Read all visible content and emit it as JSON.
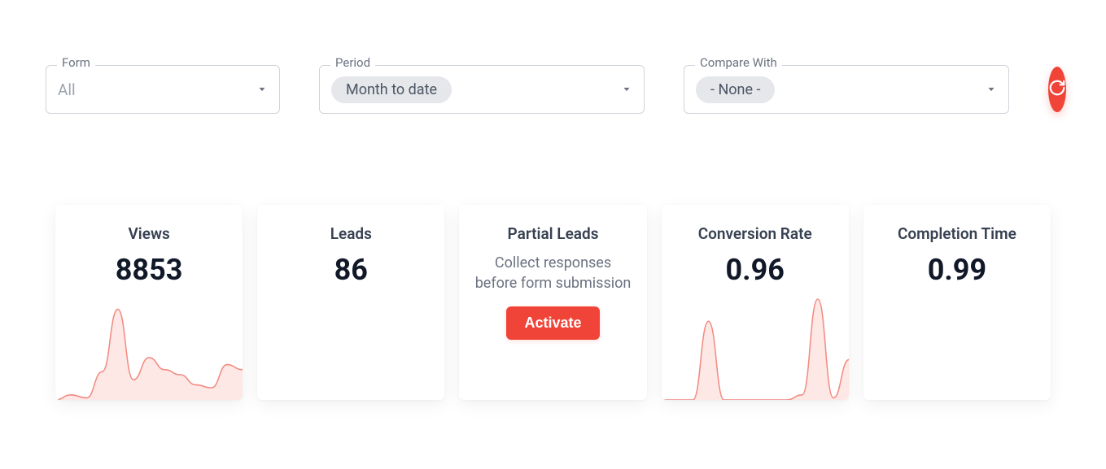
{
  "filters": {
    "form": {
      "label": "Form",
      "value": "All"
    },
    "period": {
      "label": "Period",
      "chip": "Month to date"
    },
    "compare": {
      "label": "Compare With",
      "chip": "- None -"
    }
  },
  "cards": {
    "views": {
      "title": "Views",
      "value": "8853"
    },
    "leads": {
      "title": "Leads",
      "value": "86"
    },
    "partial_leads": {
      "title": "Partial Leads",
      "desc": "Collect responses before form submission",
      "button": "Activate"
    },
    "conversion_rate": {
      "title": "Conversion Rate",
      "value": "0.96"
    },
    "completion_time": {
      "title": "Completion Time",
      "value": "0.99"
    }
  },
  "colors": {
    "accent": "#f04438"
  },
  "chart_data": [
    {
      "type": "area",
      "card": "views",
      "x": [
        0,
        1,
        2,
        3,
        4,
        5,
        6,
        7,
        8,
        9,
        10,
        11,
        12
      ],
      "values": [
        0,
        5,
        2,
        28,
        90,
        20,
        42,
        30,
        25,
        15,
        12,
        35,
        30
      ],
      "ylim": [
        0,
        100
      ]
    },
    {
      "type": "area",
      "card": "conversion_rate",
      "x": [
        0,
        1,
        2,
        3,
        4,
        5,
        6,
        7,
        8,
        9,
        10,
        11,
        12
      ],
      "values": [
        0,
        0,
        0,
        78,
        0,
        0,
        0,
        0,
        0,
        5,
        100,
        2,
        40
      ],
      "ylim": [
        0,
        100
      ]
    }
  ]
}
